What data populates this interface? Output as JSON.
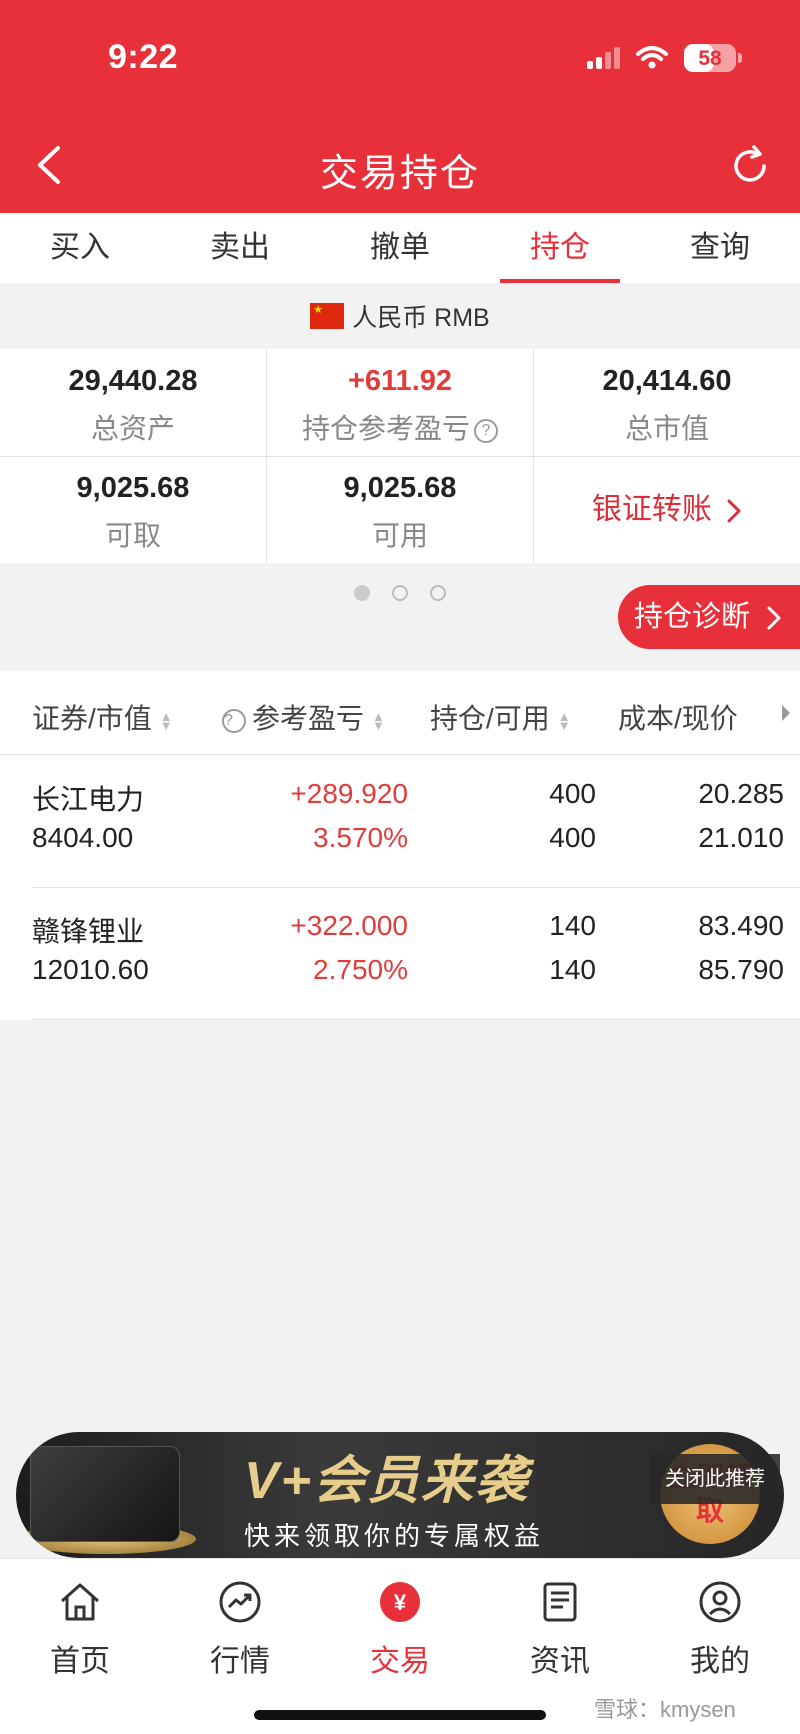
{
  "status": {
    "time": "9:22",
    "battery": "58"
  },
  "header": {
    "title": "交易持仓"
  },
  "tabs": [
    {
      "label": "买入"
    },
    {
      "label": "卖出"
    },
    {
      "label": "撤单"
    },
    {
      "label": "持仓",
      "active": true
    },
    {
      "label": "查询"
    }
  ],
  "currency": {
    "label": "人民币 RMB"
  },
  "assets": {
    "total_assets": {
      "value": "29,440.28",
      "label": "总资产"
    },
    "pnl": {
      "value": "+611.92",
      "label": "持仓参考盈亏"
    },
    "market_value": {
      "value": "20,414.60",
      "label": "总市值"
    },
    "withdrawable": {
      "value": "9,025.68",
      "label": "可取"
    },
    "available": {
      "value": "9,025.68",
      "label": "可用"
    },
    "transfer_label": "银证转账"
  },
  "diagnose_label": "持仓诊断",
  "table": {
    "headers": [
      "证券/市值",
      "参考盈亏",
      "持仓/可用",
      "成本/现价"
    ],
    "rows": [
      {
        "name": "长江电力",
        "market_value": "8404.00",
        "pnl": "+289.920",
        "pnl_pct": "3.570%",
        "position": "400",
        "available": "400",
        "cost": "20.285",
        "price": "21.010"
      },
      {
        "name": "赣锋锂业",
        "market_value": "12010.60",
        "pnl": "+322.000",
        "pnl_pct": "2.750%",
        "position": "140",
        "available": "140",
        "cost": "83.490",
        "price": "85.790"
      }
    ]
  },
  "ad": {
    "title": "V+会员来袭",
    "subtitle": "快来领取你的专属权益",
    "claim": "立即领取",
    "close": "关闭此推荐"
  },
  "bottom_nav": [
    {
      "label": "首页"
    },
    {
      "label": "行情"
    },
    {
      "label": "交易",
      "active": true
    },
    {
      "label": "资讯"
    },
    {
      "label": "我的"
    }
  ],
  "watermark": "雪球：kmysen",
  "colors": {
    "brand": "#e8303a",
    "gain": "#e03c3c"
  }
}
